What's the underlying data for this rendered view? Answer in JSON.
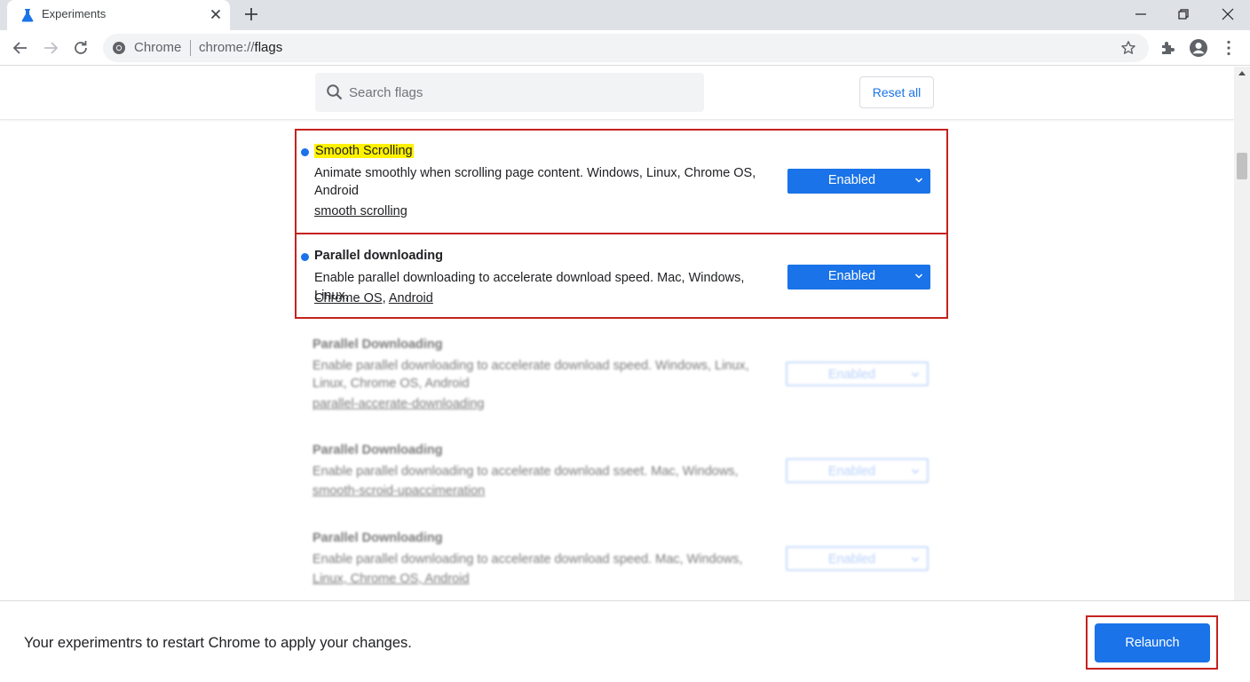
{
  "tab": {
    "title": "Experiments"
  },
  "omnibox": {
    "site_label": "Chrome",
    "url_scheme": "chrome://",
    "url_host": "flags"
  },
  "search": {
    "placeholder": "Search flags",
    "value": ""
  },
  "header": {
    "reset_label": "Reset all"
  },
  "flags": [
    {
      "name": "Smooth Scrolling",
      "description": "Animate smoothly when scrolling page content. Windows, Linux, Chrome OS, Android",
      "link": "smooth scrolling",
      "state": "Enabled"
    },
    {
      "name": "Parallel downloading",
      "description": "Enable parallel downloading to accelerate download speed. Mac, Windows, Linux,",
      "link_a": "Chrome OS",
      "link_sep": ", ",
      "link_b": "Android",
      "state": "Enabled"
    },
    {
      "name": "Parallel Downloading",
      "description": "Enable parallel downloading to accelerate download speed. Windows, Linux, Linux, Chrome OS, Android",
      "link": "parallel-accerate-downloading",
      "state": "Enabled"
    },
    {
      "name": "Parallel Downloading",
      "description": "Enable parallel downloading to accelerate download sseet. Mac, Windows,",
      "link": "smooth-scroid-upaccimeration",
      "state": "Enabled"
    },
    {
      "name": "Parallel Downloading",
      "description": "Enable parallel downloading to accelerate download speed. Mac, Windows,",
      "link": "Linux, Chrome OS, Android",
      "state": "Enabled"
    }
  ],
  "relaunch": {
    "message": "Your experimentrs to restart Chrome to apply your changes.",
    "button_label": "Relaunch"
  },
  "colors": {
    "accent": "#1a73e8",
    "highlight_border": "#c5221f",
    "search_highlight": "#fff200"
  }
}
